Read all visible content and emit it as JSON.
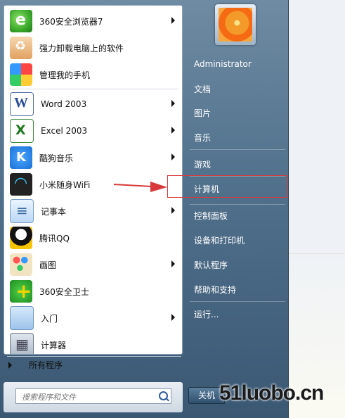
{
  "start_menu": {
    "pinned_programs": [
      {
        "label": "360安全浏览器7",
        "icon": "360-browser-icon",
        "has_arrow": true
      },
      {
        "label": "强力卸载电脑上的软件",
        "icon": "uninstall-icon",
        "has_arrow": false
      },
      {
        "label": "管理我的手机",
        "icon": "phone-manager-icon",
        "has_arrow": false
      },
      {
        "label": "Word 2003",
        "icon": "word-icon",
        "has_arrow": true
      },
      {
        "label": "Excel 2003",
        "icon": "excel-icon",
        "has_arrow": true
      },
      {
        "label": "酷狗音乐",
        "icon": "kugou-music-icon",
        "has_arrow": true
      },
      {
        "label": "小米随身WiFi",
        "icon": "wifi-icon",
        "has_arrow": false
      },
      {
        "label": "记事本",
        "icon": "notepad-icon",
        "has_arrow": true
      },
      {
        "label": "腾讯QQ",
        "icon": "qq-icon",
        "has_arrow": false
      },
      {
        "label": "画图",
        "icon": "paint-icon",
        "has_arrow": true
      },
      {
        "label": "360安全卫士",
        "icon": "360-security-icon",
        "has_arrow": false
      },
      {
        "label": "入门",
        "icon": "getting-started-icon",
        "has_arrow": true
      },
      {
        "label": "计算器",
        "icon": "calculator-icon",
        "has_arrow": false
      }
    ],
    "all_programs_label": "所有程序",
    "search_placeholder": "搜索程序和文件",
    "right_pane": {
      "user_name": "Administrator",
      "items": [
        "文档",
        "图片",
        "音乐",
        "游戏",
        "计算机",
        "控制面板",
        "设备和打印机",
        "默认程序",
        "帮助和支持",
        "运行..."
      ],
      "highlighted_item": "计算机"
    },
    "shutdown_label": "关机"
  },
  "watermark": "51luobo.cn",
  "colors": {
    "annotation": "#d8393a",
    "menu_blue": "#50708b"
  }
}
